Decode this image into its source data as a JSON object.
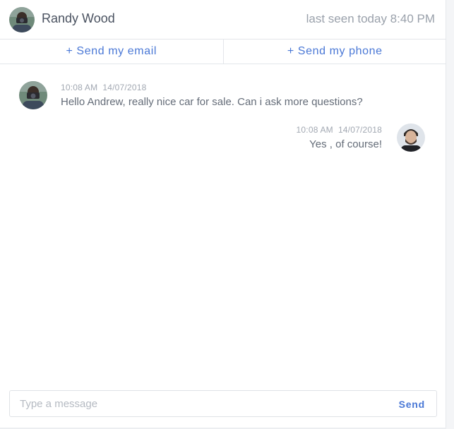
{
  "header": {
    "name": "Randy Wood",
    "last_seen": "last seen today 8:40 PM"
  },
  "actions": {
    "send_email": "+ Send my email",
    "send_phone": "+ Send my phone"
  },
  "messages": [
    {
      "time": "10:08 AM",
      "date": "14/07/2018",
      "text": "Hello Andrew, really nice car for sale. Can i ask more questions?",
      "side": "left"
    },
    {
      "time": "10:08 AM",
      "date": "14/07/2018",
      "text": "Yes , of course!",
      "side": "right"
    }
  ],
  "composer": {
    "placeholder": "Type a message",
    "send_label": "Send"
  },
  "colors": {
    "accent": "#4a78d6",
    "border": "#e3e6ea"
  }
}
